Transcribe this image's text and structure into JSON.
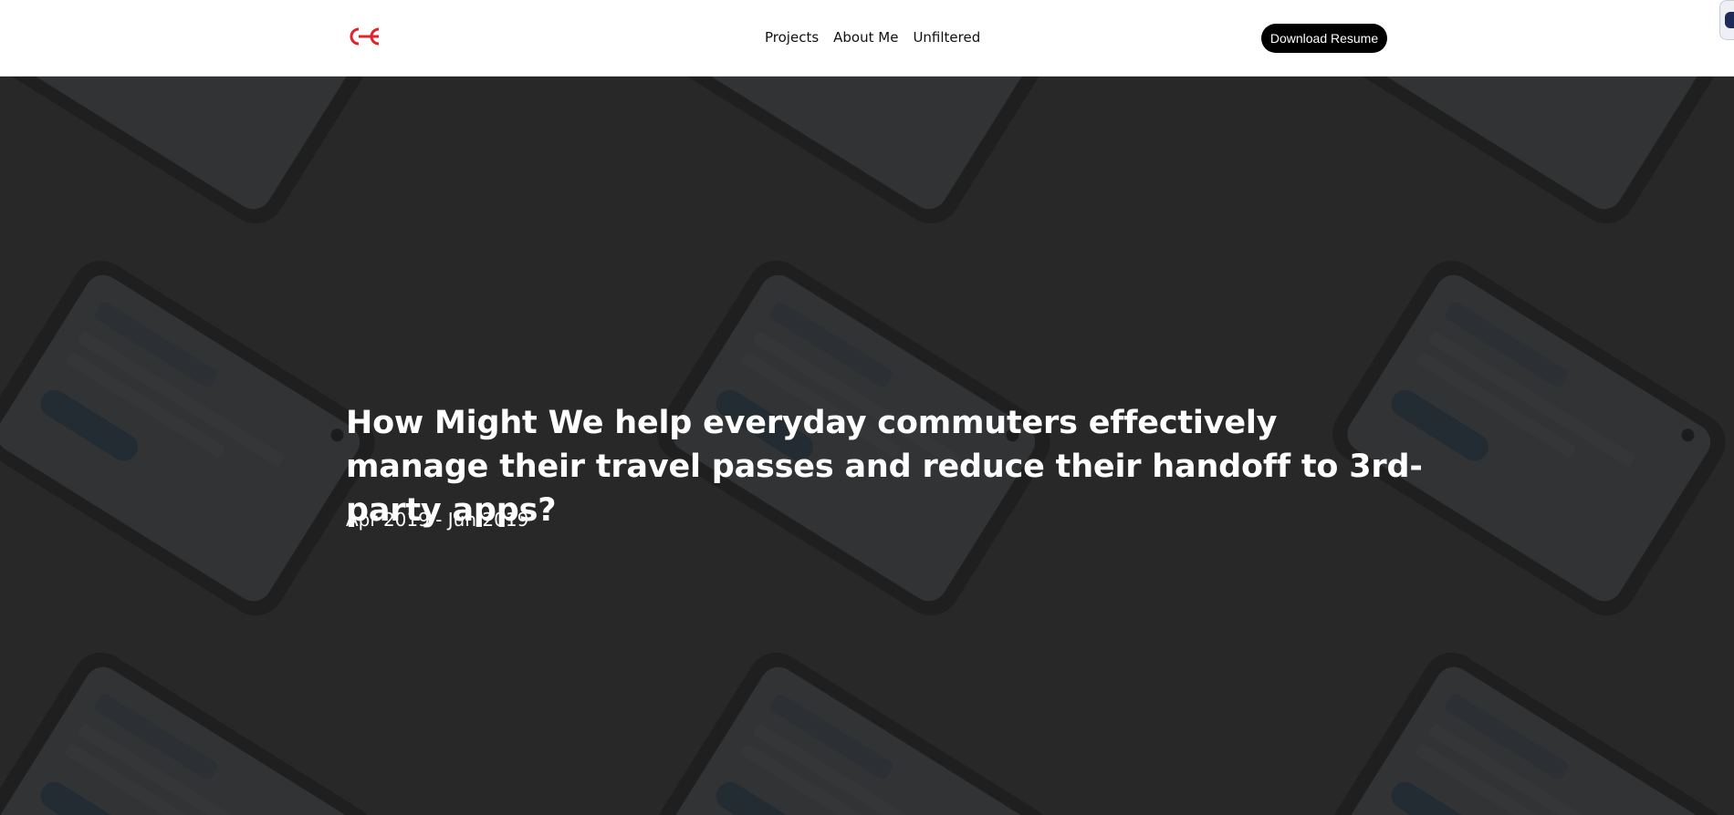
{
  "nav": {
    "logo_icon": "cc-monogram-icon",
    "links": [
      "Projects",
      "About Me",
      "Unfiltered"
    ],
    "cta_label": "Download Resume"
  },
  "hero": {
    "title": "How Might We help everyday commuters effectively manage their travel passes and reduce their handoff to 3rd-party apps?",
    "date_range": "Apr 2019 - Jun 2019",
    "background": "grid-of-phone-mockups-image"
  },
  "colors": {
    "brand": "#e0242c",
    "nav_bg": "#ffffff",
    "hero_overlay": "#2e2e2e",
    "text_light": "#ffffff",
    "button_bg": "#000000"
  }
}
